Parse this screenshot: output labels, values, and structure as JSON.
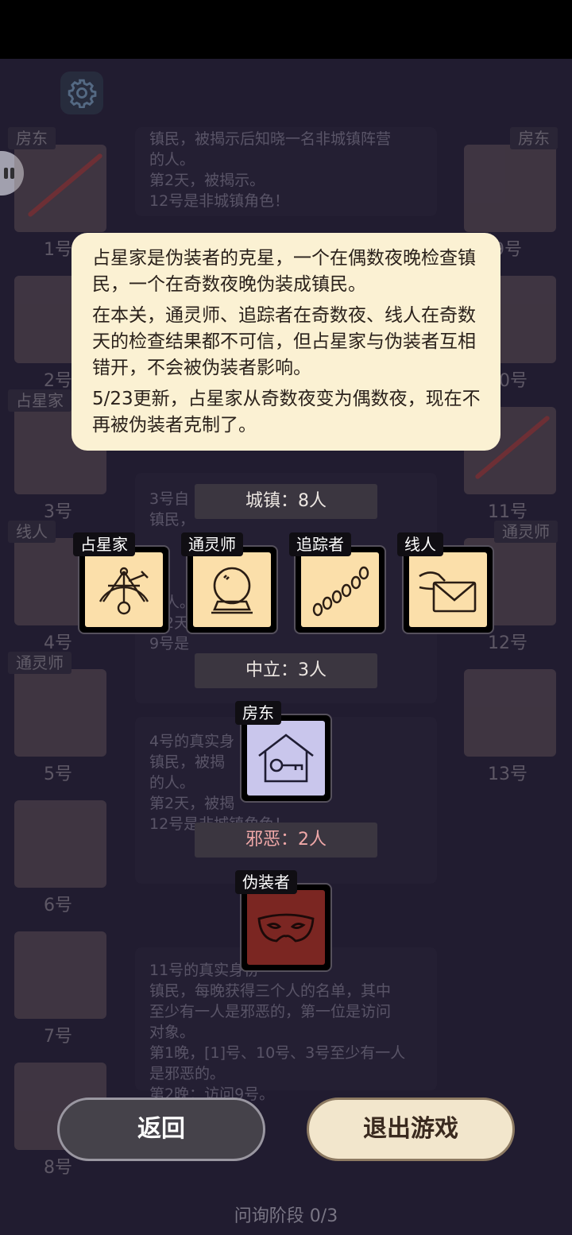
{
  "board": {
    "slots": [
      {
        "role": "房东",
        "number": "1号"
      },
      {
        "role": "",
        "number": "2号"
      },
      {
        "role": "占星家",
        "number": "3号"
      },
      {
        "role": "线人",
        "number": "4号"
      },
      {
        "role": "通灵师",
        "number": "5号"
      },
      {
        "role": "",
        "number": "6号"
      },
      {
        "role": "",
        "number": "7号"
      },
      {
        "role": "",
        "number": "8号"
      },
      {
        "role": "房东",
        "number": "9号"
      },
      {
        "role": "",
        "number": "10号"
      },
      {
        "role": "",
        "number": "11号"
      },
      {
        "role": "通灵师",
        "number": "12号"
      },
      {
        "role": "",
        "number": "13号"
      }
    ],
    "logs": [
      "镇民，被揭示后知晓一名非城镇阵营\n的人。\n第2天，被揭示。\n12号是非城镇角色！",
      "3号自\n镇民，\n\n\n\n因人。\n第2天\n9号是",
      "4号的真实身\n镇民，被揭\n的人。\n第2天，被揭\n12号是非城镇角色！",
      "11号的真实身份\n镇民，每晚获得三个人的名单，其中\n至少有一人是邪恶的，第一位是访问\n对象。\n第1晚，[1]号、10号、3号至少有一人\n是邪恶的。\n第2晚：访问9号。"
    ]
  },
  "tooltip": {
    "p1": "占星家是伪装者的克星，一个在偶数夜晚检查镇民，一个在奇数夜晚伪装成镇民。",
    "p2": "在本关，通灵师、追踪者在奇数夜、线人在奇数天的检查结果都不可信，但占星家与伪装者互相错开，不会被伪装者影响。",
    "p3": "5/23更新，占星家从奇数夜变为偶数夜，现在不再被伪装者克制了。"
  },
  "categories": {
    "town": {
      "label": "城镇：8人",
      "roles": [
        "占星家",
        "通灵师",
        "追踪者",
        "线人"
      ]
    },
    "neutral": {
      "label": "中立：3人",
      "roles": [
        "房东"
      ]
    },
    "evil": {
      "label": "邪恶：2人",
      "roles": [
        "伪装者"
      ]
    }
  },
  "buttons": {
    "back": "返回",
    "exit": "退出游戏"
  },
  "phase": "问询阶段 0/3",
  "icons": [
    "gear-icon",
    "sextant-icon",
    "crystal-ball-icon",
    "footprints-icon",
    "envelope-icon",
    "house-key-icon",
    "mask-icon",
    "user-unknown-icon"
  ]
}
